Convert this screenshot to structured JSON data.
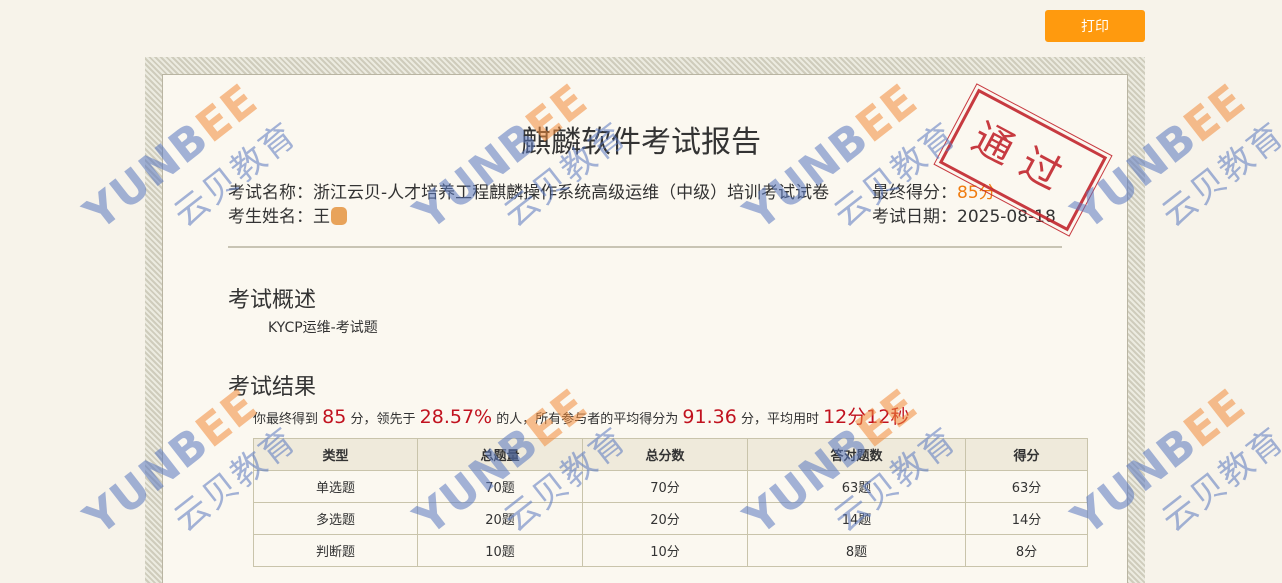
{
  "toolbar": {
    "print_label": "打印"
  },
  "report": {
    "title": "麒麟软件考试报告",
    "exam_name_label": "考试名称：",
    "exam_name": "浙江云贝-人才培养工程麒麟操作系统高级运维（中级）培训考试试卷",
    "final_score_label": "最终得分：",
    "final_score": "85分",
    "candidate_label": "考生姓名：",
    "candidate_name": "王",
    "exam_date_label": "考试日期：",
    "exam_date": "2025-08-18",
    "stamp_text": "通过"
  },
  "overview": {
    "heading": "考试概述",
    "text": "KYCP运维-考试题"
  },
  "results": {
    "heading": "考试结果",
    "summary": {
      "p1": "你最终得到",
      "score": "85",
      "p2": "分，领先于",
      "percent": "28.57%",
      "p3": "的人，所有参与者的平均得分为",
      "avg": "91.36",
      "p4": "分，平均用时",
      "time": "12分12秒"
    },
    "columns": [
      "类型",
      "总题量",
      "总分数",
      "答对题数",
      "得分"
    ],
    "rows": [
      [
        "单选题",
        "70题",
        "70分",
        "63题",
        "63分"
      ],
      [
        "多选题",
        "20题",
        "20分",
        "14题",
        "14分"
      ],
      [
        "判断题",
        "10题",
        "10分",
        "8题",
        "8分"
      ]
    ]
  },
  "watermark": {
    "brand_left": "YUNB",
    "brand_ee": "EE",
    "brand_cn": "云贝教育"
  },
  "colors": {
    "accent": "#ff9a0e",
    "score": "#f07c10",
    "highlight": "#c1121f",
    "stamp": "#c2262e",
    "watermark": "#5a78c0"
  }
}
